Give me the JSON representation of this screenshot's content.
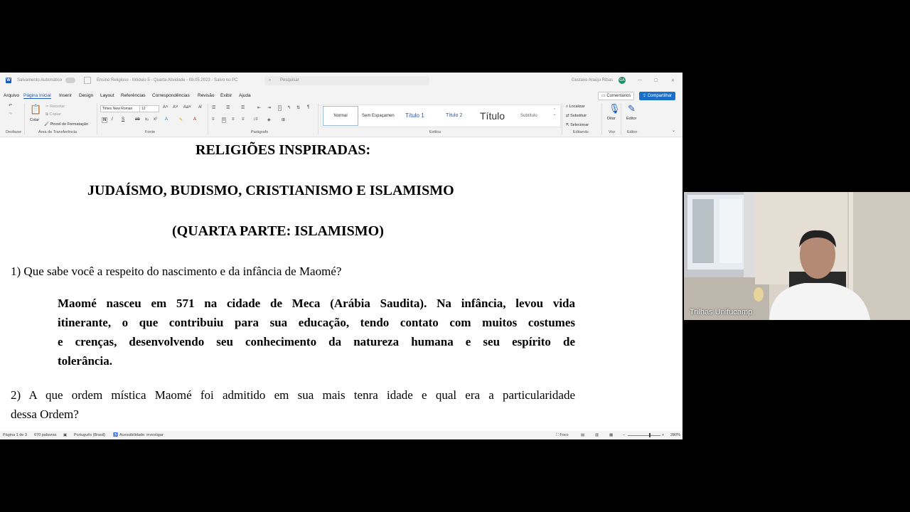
{
  "title_bar": {
    "autosave_label": "Salvamento Automático",
    "doc_title": "Ensino Religioso - Módulo 5 - Quarta Atividade - 08.05.2023 - Salvo no PC",
    "search_placeholder": "Pesquisar",
    "user_name": "Gustavo Araújo Ribas",
    "user_initials": "GA"
  },
  "menu": {
    "tabs": [
      "Arquivo",
      "Página Inicial",
      "Inserir",
      "Design",
      "Layout",
      "Referências",
      "Correspondências",
      "Revisão",
      "Exibir",
      "Ajuda"
    ],
    "active_tab": "Página Inicial",
    "comments_label": "Comentários",
    "share_label": "Compartilhar"
  },
  "ribbon": {
    "groups": [
      "Desfazer",
      "Área de Transferência",
      "Fonte",
      "Parágrafo",
      "Estilos",
      "Editando",
      "Voz",
      "Editor"
    ],
    "paste_label": "Colar",
    "cut_label": "Recortar",
    "copy_label": "Copiar",
    "format_painter_label": "Pincel de Formatação",
    "font_name": "Times New Roman",
    "font_size": "12",
    "styles": [
      "Normal",
      "Sem Espaçamen",
      "Título 1",
      "Título 2",
      "Título",
      "Subtítulo"
    ],
    "find_label": "Localizar",
    "replace_label": "Substituir",
    "select_label": "Selecionar",
    "dictate_label": "Ditar",
    "editor_label": "Editor"
  },
  "document": {
    "heading1": "RELIGIÕES INSPIRADAS:",
    "heading2": "JUDAÍSMO, BUDISMO, CRISTIANISMO E ISLAMISMO",
    "heading3": "(QUARTA PARTE: ISLAMISMO)",
    "question1": "1) Que sabe você a respeito do nascimento e da infância de Maomé?",
    "answer1_lines": [
      "Maomé nasceu em 571 na cidade de Meca (Arábia Saudita). Na infância, levou vida",
      "itinerante, o que contribuiu para sua educação, tendo contato com muitos costumes",
      "e crenças, desenvolvendo seu conhecimento da natureza humana e seu espírito de",
      "tolerância."
    ],
    "question2_lines": [
      "2) A que ordem mística Maomé foi admitido em sua mais tenra idade e qual era a particularidade",
      "dessa Ordem?"
    ]
  },
  "status_bar": {
    "page": "Página 1 de 3",
    "words": "670 palavras",
    "language": "Português (Brasil)",
    "accessibility": "Acessibilidade: investigar",
    "focus": "Foco",
    "zoom": "280%"
  },
  "video": {
    "participant_name": "Trilhas Unifucamp"
  },
  "colors": {
    "accent": "#185abd",
    "share_button": "#1a6fc9",
    "avatar": "#1f8f6a"
  }
}
